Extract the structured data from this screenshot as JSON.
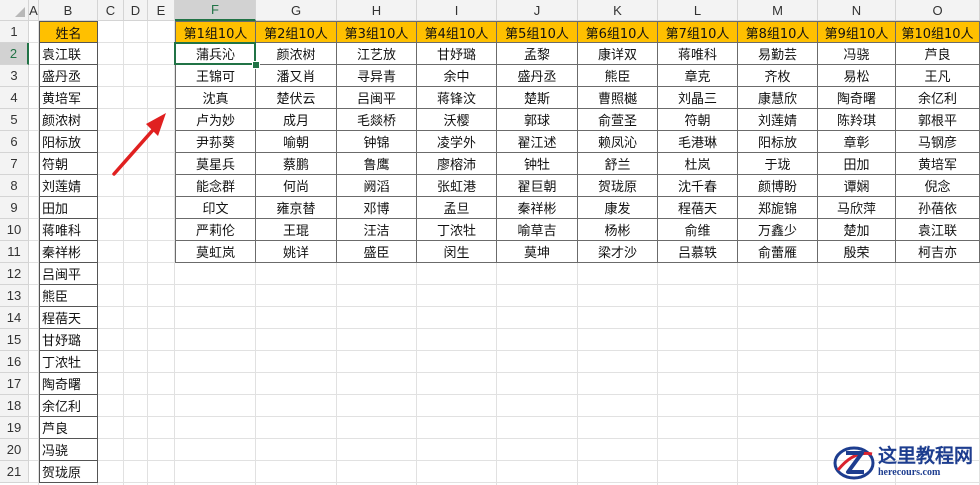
{
  "sheet": {
    "column_letters": [
      "A",
      "B",
      "C",
      "D",
      "E",
      "F",
      "G",
      "H",
      "I",
      "J",
      "K",
      "L",
      "M",
      "N",
      "O"
    ],
    "row_numbers": [
      "1",
      "2",
      "3",
      "4",
      "5",
      "6",
      "7",
      "8",
      "9",
      "10",
      "11",
      "12",
      "13",
      "14",
      "15",
      "16",
      "17",
      "18",
      "19",
      "20",
      "21"
    ],
    "active_cell": "F2",
    "name_header": "姓名",
    "names": [
      "袁江联",
      "盛丹丞",
      "黄培军",
      "颜浓树",
      "阳标放",
      "符朝",
      "刘莲婧",
      "田加",
      "蒋唯科",
      "秦祥彬",
      "吕闽平",
      "熊臣",
      "程蓓天",
      "甘妤璐",
      "丁浓牡",
      "陶奇曙",
      "余亿利",
      "芦良",
      "冯骁",
      "贺珑原"
    ],
    "group_headers": [
      "第1组10人",
      "第2组10人",
      "第3组10人",
      "第4组10人",
      "第5组10人",
      "第6组10人",
      "第7组10人",
      "第8组10人",
      "第9组10人",
      "第10组10人"
    ],
    "groups": [
      [
        "蒲兵沁",
        "颜浓树",
        "江艺放",
        "甘妤璐",
        "孟黎",
        "康详双",
        "蒋唯科",
        "易勤芸",
        "冯骁",
        "芦良"
      ],
      [
        "王锦可",
        "潘又肖",
        "寻异青",
        "余中",
        "盛丹丞",
        "熊臣",
        "章克",
        "齐枚",
        "易松",
        "王凡"
      ],
      [
        "沈真",
        "楚伏云",
        "吕闽平",
        "蒋锋汶",
        "楚斯",
        "曹照樾",
        "刘晶三",
        "康慧欣",
        "陶奇曙",
        "余亿利"
      ],
      [
        "卢为妙",
        "成月",
        "毛燚桥",
        "沃樱",
        "郭球",
        "俞萱圣",
        "符朝",
        "刘莲婧",
        "陈羚琪",
        "郭根平"
      ],
      [
        "尹荪葵",
        "喻朝",
        "钟锦",
        "凌学外",
        "翟江述",
        "赖凤沁",
        "毛港琳",
        "阳标放",
        "章彰",
        "马钢彦"
      ],
      [
        "莫星兵",
        "蔡鹏",
        "鲁鹰",
        "廖榕沛",
        "钟牡",
        "舒兰",
        "杜岚",
        "于珑",
        "田加",
        "黄培军"
      ],
      [
        "能念群",
        "何尚",
        "阙滔",
        "张虹港",
        "翟巨朝",
        "贺珑原",
        "沈千春",
        "颜博盼",
        "谭娴",
        "倪念"
      ],
      [
        "印文",
        "雍京替",
        "邓博",
        "孟旦",
        "秦祥彬",
        "康发",
        "程蓓天",
        "郑旎锦",
        "马欣萍",
        "孙蓓依"
      ],
      [
        "严莉伦",
        "王琨",
        "汪洁",
        "丁浓牡",
        "喻草吉",
        "杨彬",
        "俞维",
        "万鑫少",
        "楚加",
        "袁江联"
      ],
      [
        "莫虹岚",
        "姚详",
        "盛臣",
        "闵生",
        "莫坤",
        "梁才沙",
        "吕慕轶",
        "俞蕾雁",
        "殷荣",
        "柯吉亦"
      ]
    ]
  },
  "annotation": {
    "arrow_color": "#e02020"
  },
  "watermark": {
    "text_cn": "这里教程网",
    "url": "herecours.com",
    "logo_icon": "z-swirl-logo-icon"
  },
  "colors": {
    "header_fill": "#ffc000",
    "selection_green": "#217346"
  }
}
